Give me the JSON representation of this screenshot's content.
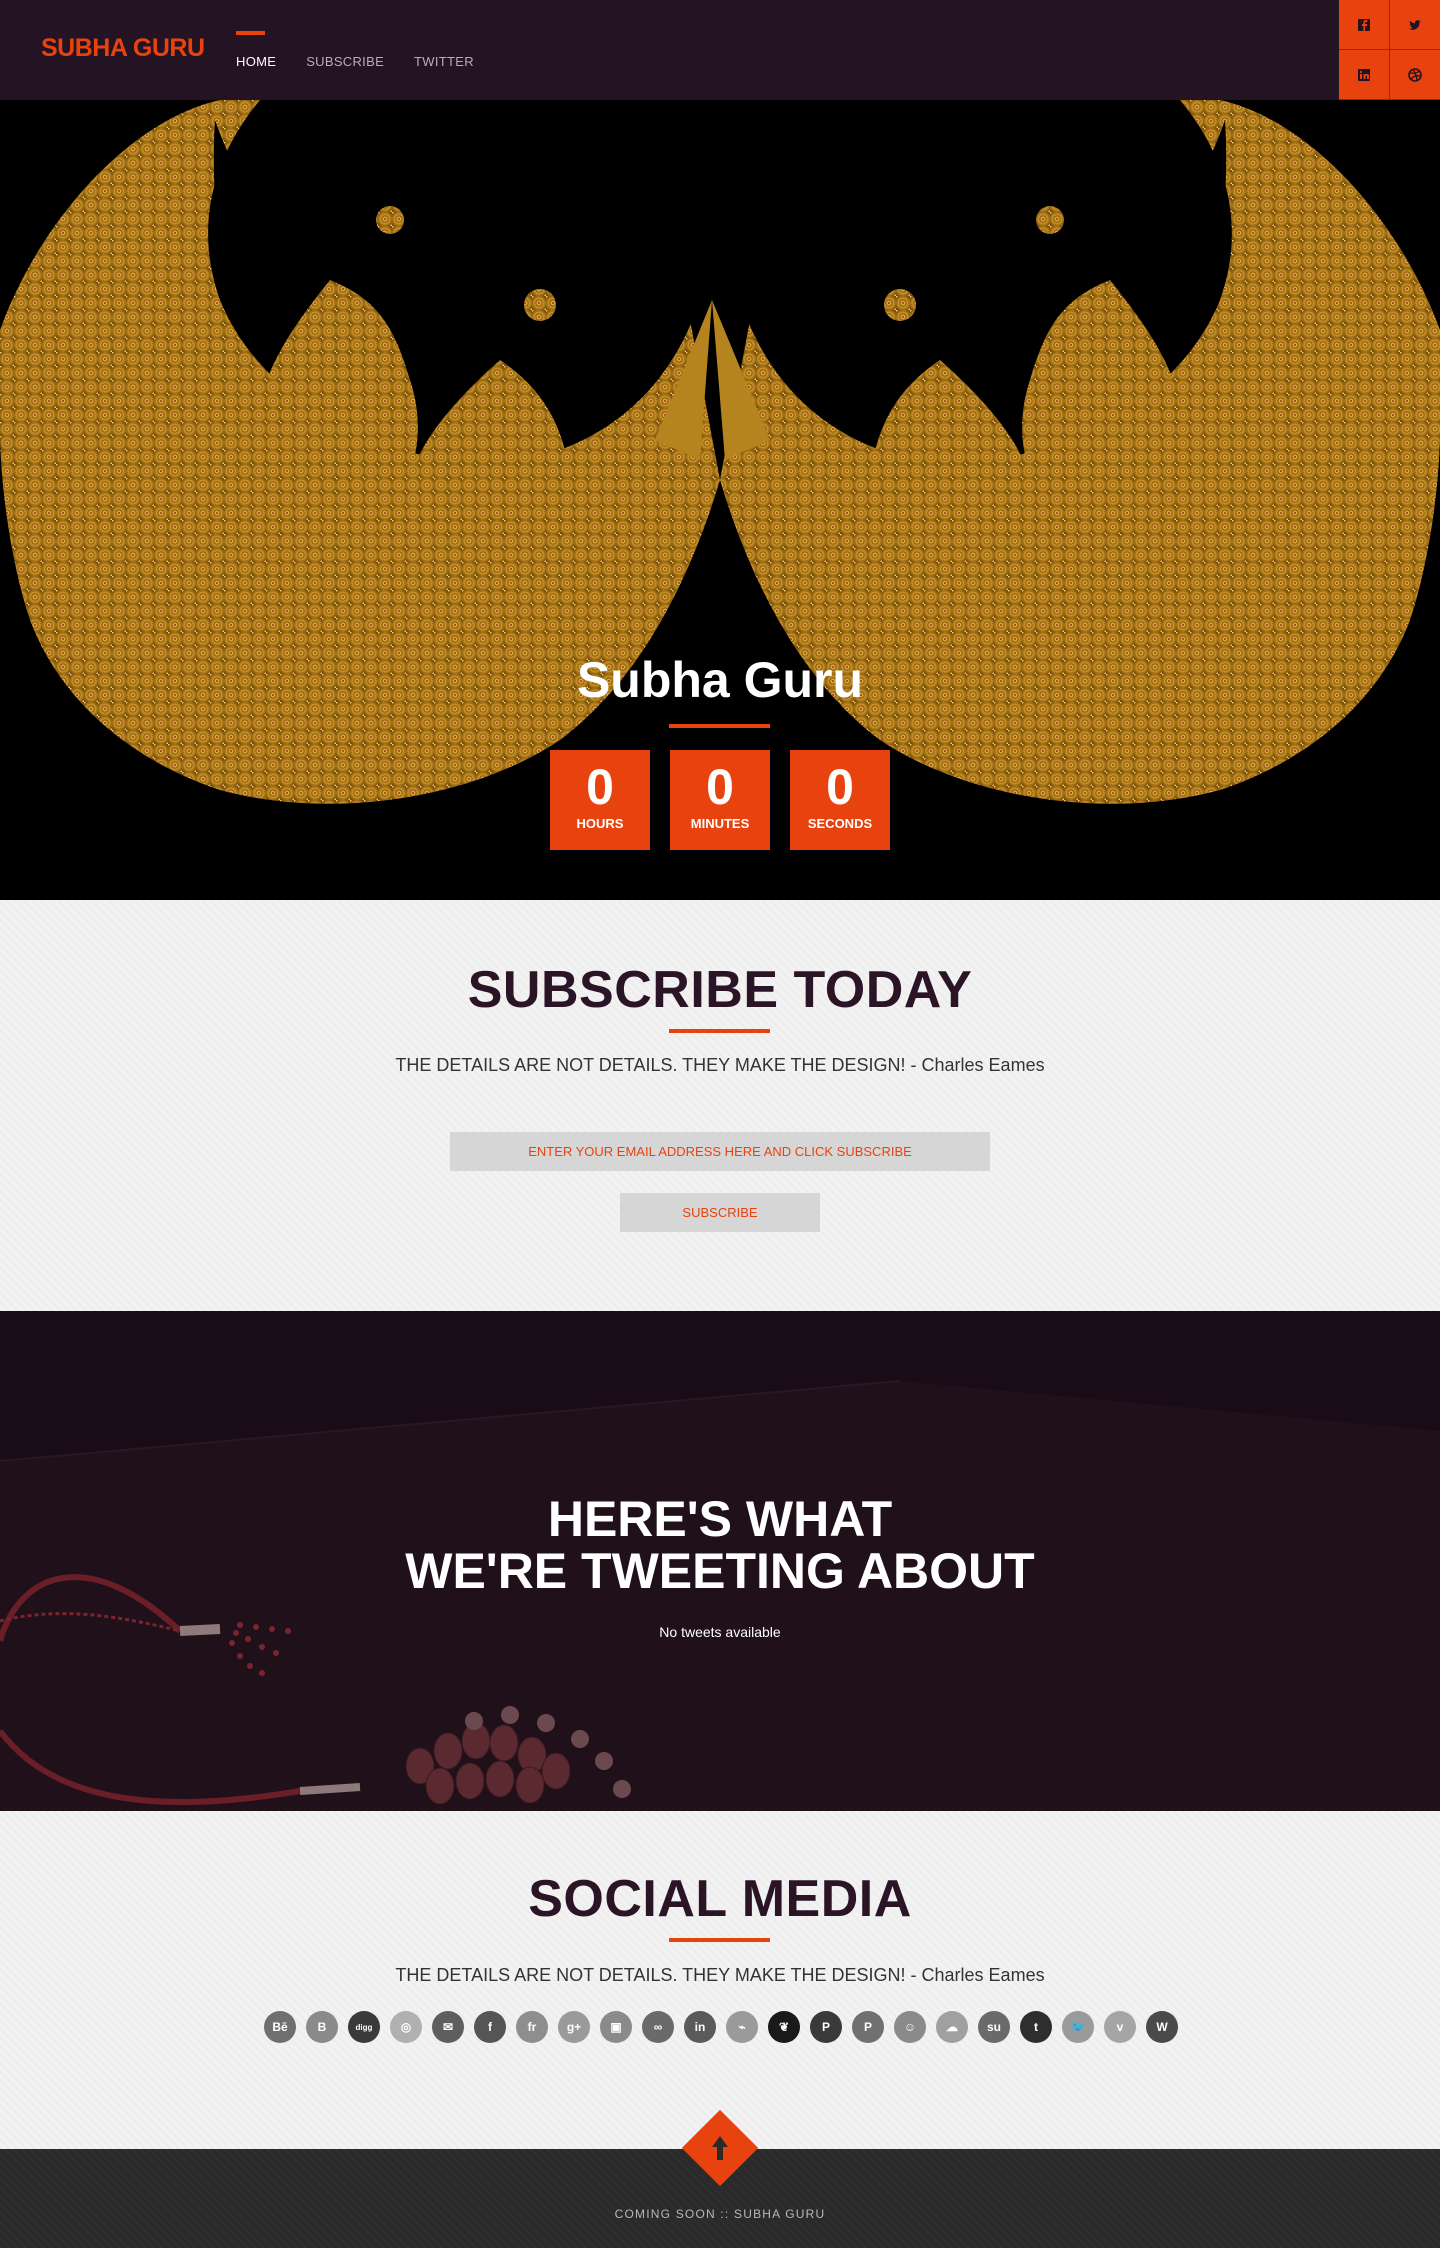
{
  "header": {
    "logo": "SUBHA GURU",
    "nav": [
      {
        "label": "HOME",
        "active": true
      },
      {
        "label": "SUBSCRIBE",
        "active": false
      },
      {
        "label": "TWITTER",
        "active": false
      }
    ],
    "social_squares": [
      "facebook-icon",
      "twitter-icon",
      "linkedin-icon",
      "dribbble-icon"
    ]
  },
  "hero": {
    "title": "Subha Guru",
    "countdown": [
      {
        "value": "0",
        "label": "HOURS"
      },
      {
        "value": "0",
        "label": "MINUTES"
      },
      {
        "value": "0",
        "label": "SECONDS"
      }
    ]
  },
  "subscribe": {
    "title": "SUBSCRIBE TODAY",
    "quote": "THE DETAILS ARE NOT DETAILS. THEY MAKE THE DESIGN! - Charles Eames",
    "email_placeholder": "ENTER YOUR EMAIL ADDRESS HERE AND CLICK SUBSCRIBE",
    "button_label": "SUBSCRIBE"
  },
  "tweets": {
    "title_line1": "HERE'S WHAT",
    "title_line2": "WE'RE TWEETING ABOUT",
    "empty_text": "No tweets available"
  },
  "social_media": {
    "title": "SOCIAL MEDIA",
    "quote": "THE DETAILS ARE NOT DETAILS. THEY MAKE THE DESIGN! - Charles Eames",
    "icons": [
      {
        "name": "behance-icon",
        "glyph": "Bē",
        "color": "#6f6f6f"
      },
      {
        "name": "blogger-icon",
        "glyph": "B",
        "color": "#8a8a8a"
      },
      {
        "name": "digg-icon",
        "glyph": "digg",
        "color": "#3a3a3a"
      },
      {
        "name": "dribbble-icon",
        "glyph": "◎",
        "color": "#b0b0b0"
      },
      {
        "name": "email-icon",
        "glyph": "✉",
        "color": "#5e5e5e"
      },
      {
        "name": "facebook-icon",
        "glyph": "f",
        "color": "#555555"
      },
      {
        "name": "flickr-icon",
        "glyph": "fr",
        "color": "#8e8e8e"
      },
      {
        "name": "googleplus-icon",
        "glyph": "g+",
        "color": "#9a9a9a"
      },
      {
        "name": "instagram-icon",
        "glyph": "▣",
        "color": "#8a8a8a"
      },
      {
        "name": "lastfm-icon",
        "glyph": "∞",
        "color": "#6a6a6a"
      },
      {
        "name": "linkedin-icon",
        "glyph": "in",
        "color": "#5a5a5a"
      },
      {
        "name": "paperclip-icon",
        "glyph": "⌁",
        "color": "#9a9a9a"
      },
      {
        "name": "evernote-icon",
        "glyph": "❦",
        "color": "#1a1a1a"
      },
      {
        "name": "paypal-icon",
        "glyph": "P",
        "color": "#3a3a3a"
      },
      {
        "name": "pinterest-icon",
        "glyph": "P",
        "color": "#707070"
      },
      {
        "name": "reddit-icon",
        "glyph": "☺",
        "color": "#8a8a8a"
      },
      {
        "name": "soundcloud-icon",
        "glyph": "☁",
        "color": "#a0a0a0"
      },
      {
        "name": "stumbleupon-icon",
        "glyph": "su",
        "color": "#6a6a6a"
      },
      {
        "name": "tumblr-icon",
        "glyph": "t",
        "color": "#2e2e2e"
      },
      {
        "name": "twitter-icon",
        "glyph": "🐦",
        "color": "#9a9a9a"
      },
      {
        "name": "vimeo-icon",
        "glyph": "v",
        "color": "#a5a5a5"
      },
      {
        "name": "wordpress-icon",
        "glyph": "W",
        "color": "#4a4a4a"
      }
    ]
  },
  "footer": {
    "text": "COMING SOON :: SUBHA GURU"
  },
  "colors": {
    "accent": "#e8420e",
    "header_bg": "#241322",
    "tweets_bg": "#1a0c17",
    "heading": "#2a1426",
    "footer_bg": "#2a2a2a"
  }
}
